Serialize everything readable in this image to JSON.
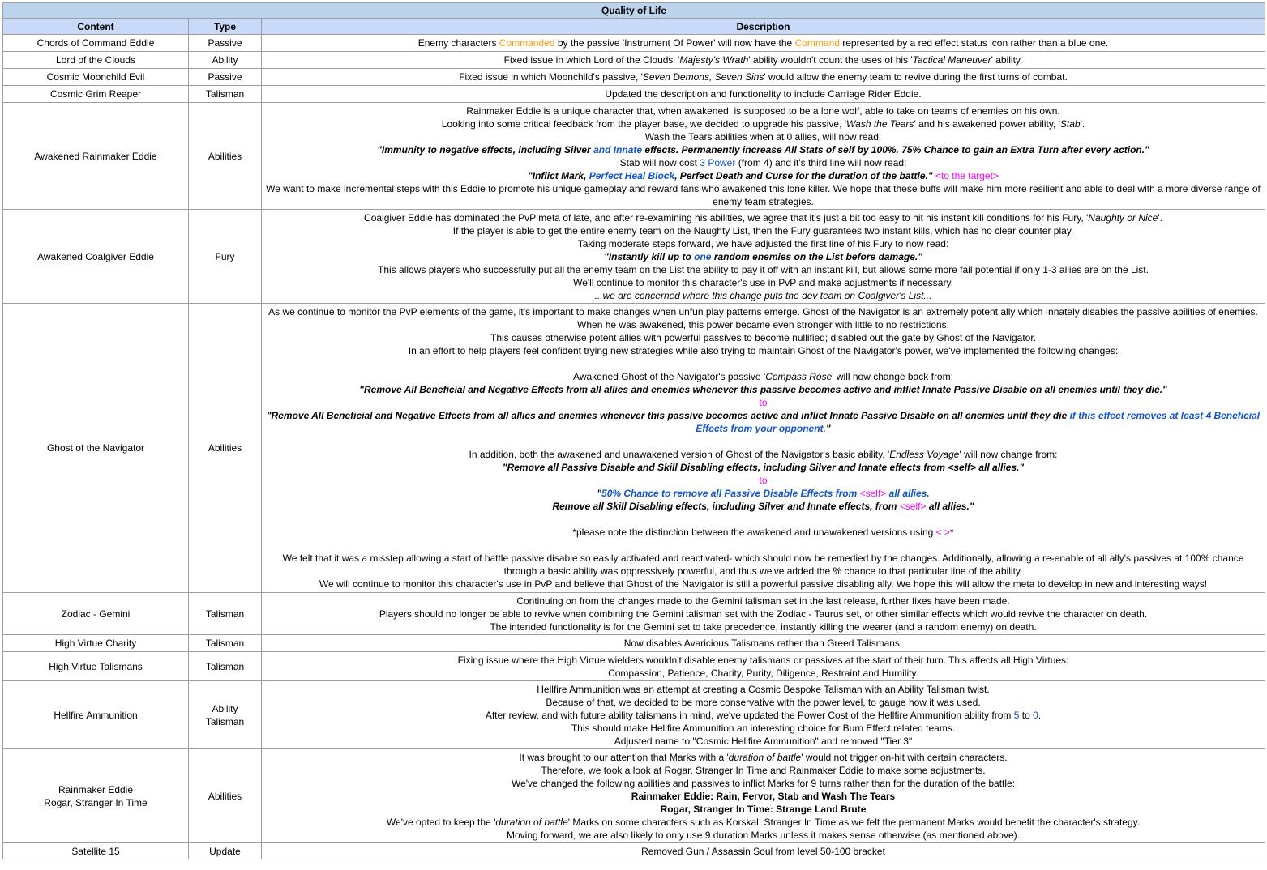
{
  "title": "Quality of Life",
  "headers": {
    "content": "Content",
    "type": "Type",
    "description": "Description"
  },
  "rows": [
    {
      "content": "Chords of Command Eddie",
      "type": "Passive",
      "d": [
        "Enemy characters ",
        "Commanded",
        " by the passive 'Instrument Of Power' will now have the ",
        "Command",
        " represented by a red effect status icon rather than a blue one."
      ]
    },
    {
      "content": "Lord of the Clouds",
      "type": "Ability",
      "d": [
        "Fixed issue in which Lord of the Clouds' '",
        "Majesty's Wrath",
        "' ability wouldn't count the uses of his '",
        "Tactical Maneuver",
        "' ability."
      ]
    },
    {
      "content": "Cosmic Moonchild Evil",
      "type": "Passive",
      "d": [
        "Fixed issue in which Moonchild's passive, '",
        "Seven Demons, Seven Sins",
        "' would allow the enemy team to revive during the first turns of combat."
      ]
    },
    {
      "content": "Cosmic Grim Reaper",
      "type": "Talisman",
      "d": [
        "Updated the description and functionality to include Carriage Rider Eddie."
      ]
    },
    {
      "content": "Awakened Rainmaker Eddie",
      "type": "Abilities",
      "d": [
        "Rainmaker Eddie is a unique character that, when awakened, is supposed to be a lone wolf, able to take on teams of enemies on his own.",
        "Looking into some critical feedback from the player base, we decided to upgrade his passive, '",
        "Wash the Tears",
        "' and his awakened power ability, '",
        "Stab",
        "'.",
        "Wash the Tears abilities when at 0 allies, will now read:",
        "\"Immunity to negative effects, including Silver ",
        "and Innate",
        " effects. Permanently increase All Stats of self by 100%. 75% Chance to gain an Extra Turn after every action.\"",
        "Stab will now cost ",
        "3 Power",
        " (from 4) and it's third line will now read:",
        "\"Inflict Mark, ",
        "Perfect Heal Block",
        ", Perfect Death and Curse for the duration of the battle.\"",
        " <to the target>",
        "We want to make incremental steps with this Eddie to promote his unique gameplay and reward fans who awakened this lone killer. We hope that these buffs will make him more resilient and able to deal with a more diverse range of enemy team strategies."
      ]
    },
    {
      "content": "Awakened Coalgiver Eddie",
      "type": "Fury",
      "d": [
        "Coalgiver Eddie has dominated the PvP meta of late, and after re-examining his abilities, we agree that it's just a bit too easy to hit his instant kill conditions for his Fury, '",
        "Naughty or Nice",
        "'.",
        "If the player is able to get the entire enemy team on the Naughty List, then the Fury guarantees two instant kills, which has no clear counter play.",
        "Taking moderate steps forward, we have adjusted the first line of his Fury to now read:",
        "\"Instantly kill up to ",
        "one",
        " random enemies on the List before damage.\"",
        "This allows players who successfully put all the enemy team on the List the ability to pay it off with an instant kill, but allows some more fail potential if only 1-3 allies are on the List.",
        "We'll continue to monitor this character's use in PvP and make adjustments if necessary.",
        "...we are concerned where this change puts the dev team on Coalgiver's List..."
      ]
    },
    {
      "content": "Ghost of the Navigator",
      "type": "Abilities",
      "d": [
        "As we continue to monitor the PvP elements of the game, it's important to make changes when unfun play patterns emerge. Ghost of the Navigator is an extremely potent ally which Innately disables the passive abilities of enemies. When he was awakened, this power became even stronger with little to no restrictions.",
        "This causes otherwise potent allies with powerful passives to become nullified; disabled out the gate by Ghost of the Navigator.",
        "In an effort to help players feel confident trying new strategies while also trying to maintain Ghost of the Navigator's power, we've implemented the following changes:",
        "Awakened Ghost of the Navigator's passive '",
        "Compass Rose",
        "' will now change back from:",
        "\"Remove All Beneficial and Negative Effects from all allies and enemies whenever this passive becomes active and inflict Innate Passive Disable on all enemies until they die.\"",
        "to",
        "\"Remove All Beneficial and Negative Effects from all allies and enemies whenever this passive becomes active and inflict Innate Passive Disable on all enemies until they die ",
        "if this effect removes at least 4 Beneficial Effects from your opponent.",
        "\"",
        "In addition, both the awakened and unawakened version of Ghost of the Navigator's basic ability, '",
        "Endless Voyage",
        "' will now change from:",
        "\"Remove all Passive Disable and Skill Disabling effects, including Silver and Innate effects from <self> all allies.\"",
        "to",
        "\"",
        "50% Chance to remove all Passive Disable Effects from ",
        "<self>",
        " all allies.",
        "Remove all Skill Disabling effects, including Silver and Innate effects, from ",
        "<self>",
        " all allies.\"",
        "*please note the distinction between the awakened and unawakened versions using ",
        "< >",
        "*",
        "We felt that it was a misstep allowing a start of battle passive disable so easily activated and reactivated- which should now be remedied by the changes. Additionally, allowing a re-enable of all ally's passives at 100% chance through a basic ability was oppressively powerful, and thus we've added the % chance to that particular line of the ability.",
        "We will continue to monitor this character's use in PvP and believe that Ghost of the Navigator is still a powerful passive disabling ally. We hope this will allow the meta to develop in new and interesting ways!"
      ]
    },
    {
      "content": "Zodiac - Gemini",
      "type": "Talisman",
      "d": [
        "Continuing on from the changes made to the Gemini talisman set in the last release, further fixes have been made.",
        "Players should no longer be able to revive when combining the Gemini talisman set with the Zodiac - Taurus set, or other similar effects which would revive the character on death.",
        "The intended functionality is for the Gemini set to take precedence, instantly killing the wearer (and a random enemy) on death."
      ]
    },
    {
      "content": "High Virtue Charity",
      "type": "Talisman",
      "d": [
        "Now disables Avaricious Talismans rather than Greed Talismans."
      ]
    },
    {
      "content": "High Virtue Talismans",
      "type": "Talisman",
      "d": [
        "Fixing issue where the High Virtue wielders wouldn't disable enemy talismans or passives at the start of their turn. This affects all High Virtues:",
        "Compassion, Patience, Charity, Purity, Diligence, Restraint and Humility."
      ]
    },
    {
      "content": "Hellfire Ammunition",
      "type": "Ability",
      "type2": "Talisman",
      "d": [
        "Hellfire Ammunition was an attempt at creating a Cosmic Bespoke Talisman with an Ability Talisman twist.",
        "Because of that, we decided to be more conservative with the power level, to gauge how it was used.",
        "After review, and with future ability talismans in mind, we've updated the Power Cost of the Hellfire Ammunition ability from ",
        "5",
        " to ",
        "0",
        ".",
        "This should make Hellfire Ammunition an interesting choice for Burn Effect related teams.",
        "Adjusted name to \"Cosmic Hellfire Ammunition\" and removed \"Tier 3\""
      ]
    },
    {
      "content": "Rainmaker Eddie",
      "content2": "Rogar, Stranger In Time",
      "type": "Abilities",
      "d": [
        "It was brought to our attention that Marks with a '",
        "duration of battle",
        "' would not trigger on-hit with certain characters.",
        "Therefore, we took a look at Rogar, Stranger In Time and Rainmaker Eddie to make some adjustments.",
        "We've changed the following abilities and passives to inflict Marks for 9 turns rather than for the duration of the battle:",
        "Rainmaker Eddie: Rain, Fervor, Stab and Wash The Tears",
        "Rogar, Stranger In Time: Strange Land Brute",
        "We've opted to keep the '",
        "duration of battle",
        "' Marks on some characters such as Korskal, Stranger In Time as we felt the permanent Marks would benefit the character's strategy.",
        "Moving forward, we are also likely to only use 9 duration Marks unless it makes sense otherwise (as mentioned above)."
      ]
    },
    {
      "content": "Satellite 15",
      "type": "Update",
      "d": [
        "Removed Gun / Assassin Soul from level 50-100 bracket"
      ]
    }
  ]
}
